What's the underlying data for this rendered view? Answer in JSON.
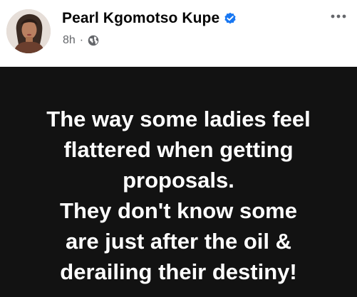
{
  "post": {
    "author": {
      "name": "Pearl Kgomotso Kupe",
      "verified": true
    },
    "timestamp": "8h",
    "separator": "·",
    "audience_icon": "globe-icon",
    "more_icon": "more-options-icon",
    "content_lines": [
      "The way some ladies feel",
      "flattered when getting",
      "proposals.",
      "They don't know some",
      "are just after the oil &",
      "derailing their destiny!"
    ]
  },
  "colors": {
    "background": "#ffffff",
    "name": "#050505",
    "meta": "#65676b",
    "verified_badge": "#1877f2",
    "post_background": "#121212",
    "post_text": "#ffffff"
  }
}
